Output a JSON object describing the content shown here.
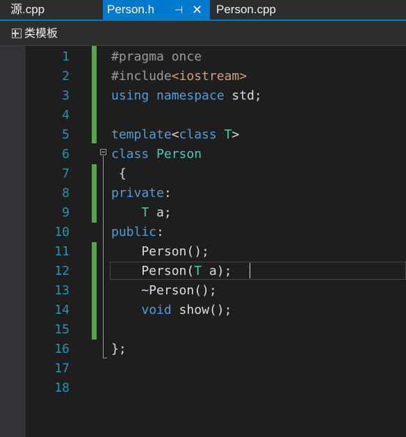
{
  "tabs": [
    {
      "label": "源.cpp",
      "active": false
    },
    {
      "label": "Person.h",
      "active": true,
      "pin_glyph": "⊣",
      "close_glyph": "✕"
    },
    {
      "label": "Person.cpp",
      "active": false
    }
  ],
  "navbar": {
    "icon": "class-template-icon",
    "label": "类模板"
  },
  "editor": {
    "line_numbers": [
      "1",
      "2",
      "3",
      "4",
      "5",
      "6",
      "7",
      "8",
      "9",
      "10",
      "11",
      "12",
      "13",
      "14",
      "15",
      "16",
      "17",
      "18"
    ],
    "lines": {
      "l1": [
        "#pragma once"
      ],
      "l2": [
        "#include",
        "<iostream>"
      ],
      "l3": [
        "using",
        " ",
        "namespace",
        " std;"
      ],
      "l4": [
        ""
      ],
      "l5": [
        "template",
        "<",
        "class",
        " ",
        "T",
        ">"
      ],
      "l6": [
        "class",
        " ",
        "Person"
      ],
      "l7": [
        " {"
      ],
      "l8": [
        "private",
        ":"
      ],
      "l9": [
        "    ",
        "T",
        " a;"
      ],
      "l10": [
        "public",
        ":"
      ],
      "l11": [
        "    Person();"
      ],
      "l12": [
        "    Person(",
        "T",
        " a);"
      ],
      "l13": [
        "    ~Person();"
      ],
      "l14": [
        "    ",
        "void",
        " show();"
      ],
      "l15": [
        ""
      ],
      "l16": [
        "};"
      ]
    }
  },
  "colors": {
    "keyword": "#569cd6",
    "type": "#4ec9b0",
    "preprocessor": "#9b9b9b",
    "include_path": "#d69d85",
    "line_number": "#2b91af",
    "change_marker": "#57a64a",
    "active_tab": "#007acc"
  }
}
